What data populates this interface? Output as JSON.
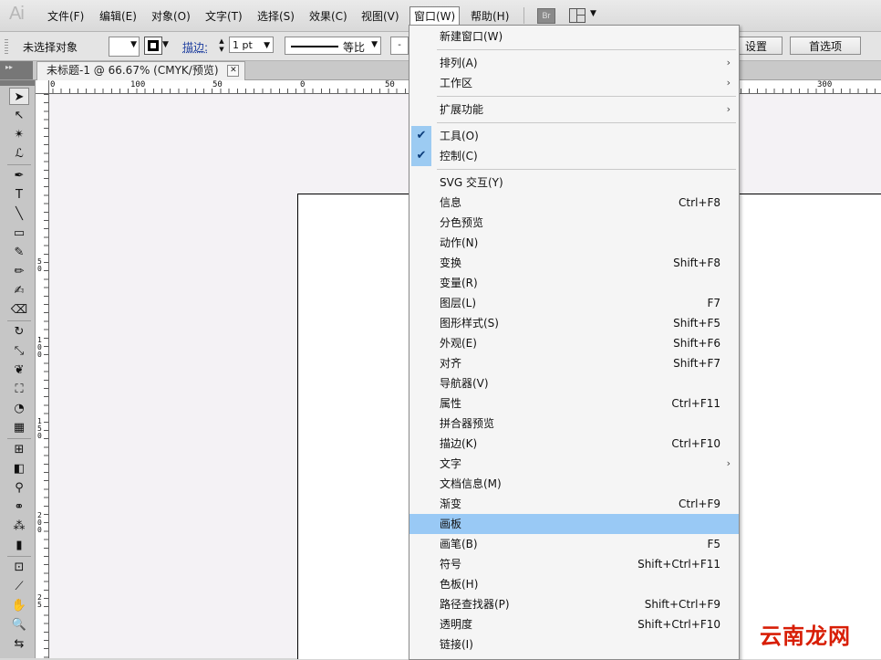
{
  "menubar": {
    "logo": "Ai",
    "items": [
      "文件(F)",
      "编辑(E)",
      "对象(O)",
      "文字(T)",
      "选择(S)",
      "效果(C)",
      "视图(V)",
      "窗口(W)",
      "帮助(H)"
    ],
    "br_label": "Br",
    "active_item": "窗口(W)"
  },
  "controlbar": {
    "selection_label": "未选择对象",
    "stroke_label": "描边:",
    "stroke_weight": "1 pt",
    "profile_label": "等比",
    "small_field": "-",
    "doc_setup_btn": "设置",
    "prefs_btn": "首选项"
  },
  "document_tab": {
    "title": "未标题-1 @ 66.67% (CMYK/预览)",
    "close": "✕"
  },
  "ruler": {
    "top_labels": [
      "0",
      "100",
      "50",
      "0",
      "50",
      "300"
    ],
    "left_labels": [
      "5\n0",
      "1\n0\n0",
      "1\n5\n0",
      "2\n0\n0",
      "2\n5"
    ]
  },
  "window_menu": {
    "groups": [
      [
        {
          "label": "新建窗口(W)",
          "shortcut": "",
          "submenu": false,
          "checked": false
        }
      ],
      [
        {
          "label": "排列(A)",
          "shortcut": "",
          "submenu": true,
          "checked": false
        },
        {
          "label": "工作区",
          "shortcut": "",
          "submenu": true,
          "checked": false
        }
      ],
      [
        {
          "label": "扩展功能",
          "shortcut": "",
          "submenu": true,
          "checked": false
        }
      ],
      [
        {
          "label": "工具(O)",
          "shortcut": "",
          "submenu": false,
          "checked": true
        },
        {
          "label": "控制(C)",
          "shortcut": "",
          "submenu": false,
          "checked": true
        }
      ],
      [
        {
          "label": "SVG 交互(Y)",
          "shortcut": "",
          "submenu": false,
          "checked": false
        },
        {
          "label": "信息",
          "shortcut": "Ctrl+F8",
          "submenu": false,
          "checked": false
        },
        {
          "label": "分色预览",
          "shortcut": "",
          "submenu": false,
          "checked": false
        },
        {
          "label": "动作(N)",
          "shortcut": "",
          "submenu": false,
          "checked": false
        },
        {
          "label": "变换",
          "shortcut": "Shift+F8",
          "submenu": false,
          "checked": false
        },
        {
          "label": "变量(R)",
          "shortcut": "",
          "submenu": false,
          "checked": false
        },
        {
          "label": "图层(L)",
          "shortcut": "F7",
          "submenu": false,
          "checked": false
        },
        {
          "label": "图形样式(S)",
          "shortcut": "Shift+F5",
          "submenu": false,
          "checked": false
        },
        {
          "label": "外观(E)",
          "shortcut": "Shift+F6",
          "submenu": false,
          "checked": false
        },
        {
          "label": "对齐",
          "shortcut": "Shift+F7",
          "submenu": false,
          "checked": false
        },
        {
          "label": "导航器(V)",
          "shortcut": "",
          "submenu": false,
          "checked": false
        },
        {
          "label": "属性",
          "shortcut": "Ctrl+F11",
          "submenu": false,
          "checked": false
        },
        {
          "label": "拼合器预览",
          "shortcut": "",
          "submenu": false,
          "checked": false
        },
        {
          "label": "描边(K)",
          "shortcut": "Ctrl+F10",
          "submenu": false,
          "checked": false
        },
        {
          "label": "文字",
          "shortcut": "",
          "submenu": true,
          "checked": false
        },
        {
          "label": "文档信息(M)",
          "shortcut": "",
          "submenu": false,
          "checked": false
        },
        {
          "label": "渐变",
          "shortcut": "Ctrl+F9",
          "submenu": false,
          "checked": false
        },
        {
          "label": "画板",
          "shortcut": "",
          "submenu": false,
          "checked": false,
          "highlighted": true
        },
        {
          "label": "画笔(B)",
          "shortcut": "F5",
          "submenu": false,
          "checked": false
        },
        {
          "label": "符号",
          "shortcut": "Shift+Ctrl+F11",
          "submenu": false,
          "checked": false
        },
        {
          "label": "色板(H)",
          "shortcut": "",
          "submenu": false,
          "checked": false
        },
        {
          "label": "路径查找器(P)",
          "shortcut": "Shift+Ctrl+F9",
          "submenu": false,
          "checked": false
        },
        {
          "label": "透明度",
          "shortcut": "Shift+Ctrl+F10",
          "submenu": false,
          "checked": false
        },
        {
          "label": "链接(I)",
          "shortcut": "",
          "submenu": false,
          "checked": false
        }
      ]
    ]
  },
  "tools": [
    {
      "name": "selection-tool-icon",
      "glyph": "➤",
      "selected": true
    },
    {
      "name": "direct-selection-tool-icon",
      "glyph": "↖",
      "selected": false
    },
    {
      "name": "magic-wand-tool-icon",
      "glyph": "✴",
      "selected": false
    },
    {
      "name": "lasso-tool-icon",
      "glyph": "ℒ",
      "selected": false
    },
    {
      "name": "pen-tool-icon",
      "glyph": "✒",
      "selected": false
    },
    {
      "name": "type-tool-icon",
      "glyph": "T",
      "selected": false
    },
    {
      "name": "line-tool-icon",
      "glyph": "╲",
      "selected": false
    },
    {
      "name": "rectangle-tool-icon",
      "glyph": "▭",
      "selected": false
    },
    {
      "name": "paintbrush-tool-icon",
      "glyph": "✎",
      "selected": false
    },
    {
      "name": "pencil-tool-icon",
      "glyph": "✏",
      "selected": false
    },
    {
      "name": "blob-brush-tool-icon",
      "glyph": "✍",
      "selected": false
    },
    {
      "name": "eraser-tool-icon",
      "glyph": "⌫",
      "selected": false
    },
    {
      "name": "rotate-tool-icon",
      "glyph": "↻",
      "selected": false
    },
    {
      "name": "scale-tool-icon",
      "glyph": "⤡",
      "selected": false
    },
    {
      "name": "warp-tool-icon",
      "glyph": "❦",
      "selected": false
    },
    {
      "name": "free-transform-tool-icon",
      "glyph": "⛶",
      "selected": false
    },
    {
      "name": "shape-builder-tool-icon",
      "glyph": "◔",
      "selected": false
    },
    {
      "name": "perspective-grid-tool-icon",
      "glyph": "▦",
      "selected": false
    },
    {
      "name": "mesh-tool-icon",
      "glyph": "⊞",
      "selected": false
    },
    {
      "name": "gradient-tool-icon",
      "glyph": "◧",
      "selected": false
    },
    {
      "name": "eyedropper-tool-icon",
      "glyph": "⚲",
      "selected": false
    },
    {
      "name": "blend-tool-icon",
      "glyph": "⚭",
      "selected": false
    },
    {
      "name": "symbol-sprayer-tool-icon",
      "glyph": "⁂",
      "selected": false
    },
    {
      "name": "column-graph-tool-icon",
      "glyph": "▮",
      "selected": false
    },
    {
      "name": "artboard-tool-icon",
      "glyph": "⊡",
      "selected": false
    },
    {
      "name": "slice-tool-icon",
      "glyph": "⟋",
      "selected": false
    },
    {
      "name": "hand-tool-icon",
      "glyph": "✋",
      "selected": false
    },
    {
      "name": "zoom-tool-icon",
      "glyph": "🔍",
      "selected": false
    },
    {
      "name": "fill-stroke-swap-icon",
      "glyph": "⇆",
      "selected": false
    }
  ],
  "watermark": "云南龙网",
  "colors": {
    "menu_highlight": "#99c9f5",
    "check_bg": "#9ccbf2",
    "canvas_bg": "#f4f2f5",
    "watermark": "#d81e06"
  }
}
